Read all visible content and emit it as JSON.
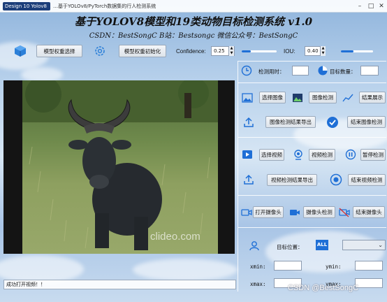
{
  "window": {
    "app_badge": "Design 10 Yolov8",
    "title": "…基于YOLOv8/PyTorch数据集的行人检测系统"
  },
  "header": {
    "title": "基于YOLOV8模型和19类动物目标检测系统 v1.0",
    "subtitle": "CSDN：BestSongC   B站：Bestsongc   微信公众号：BestSongC"
  },
  "toolbar": {
    "model_select_label": "模型权重选择",
    "model_init_label": "模型权重初始化",
    "confidence_label": "Confidence:",
    "confidence_value": "0.25",
    "confidence_level": 0.25,
    "iou_label": "IOU:",
    "iou_value": "0.40",
    "iou_level": 0.4
  },
  "image_view": {
    "watermark": "clideo.com"
  },
  "stats": {
    "time_label": "检测用时：",
    "time_value": "",
    "count_label": "目标数量：",
    "count_value": ""
  },
  "image_section": {
    "select_label": "选择图像",
    "detect_label": "图像检测",
    "show_label": "结果展示",
    "export_label": "图像检测结果导出",
    "end_label": "结束图像检测"
  },
  "video_section": {
    "select_label": "选择视频",
    "detect_label": "视频检测",
    "pause_label": "暂停检测",
    "export_label": "视频检测结果导出",
    "end_label": "结束视频检测"
  },
  "camera_section": {
    "open_label": "打开摄像头",
    "detect_label": "摄像头检测",
    "close_label": "结束摄像头"
  },
  "target": {
    "position_label": "目标位置：",
    "all_label": "ALL",
    "select_value": "",
    "xmin_label": "xmin:",
    "ymin_label": "ymin:",
    "xmax_label": "xmax:",
    "ymax_label": "ymax:",
    "xmin_value": "",
    "ymin_value": "",
    "xmax_value": "",
    "ymax_value": ""
  },
  "status": {
    "message": "成功打开视频！！"
  },
  "credit": "CSDN @BestSongC",
  "colors": {
    "accent_blue": "#1f6fd6",
    "title_bar_badge": "#1c3e7a"
  }
}
